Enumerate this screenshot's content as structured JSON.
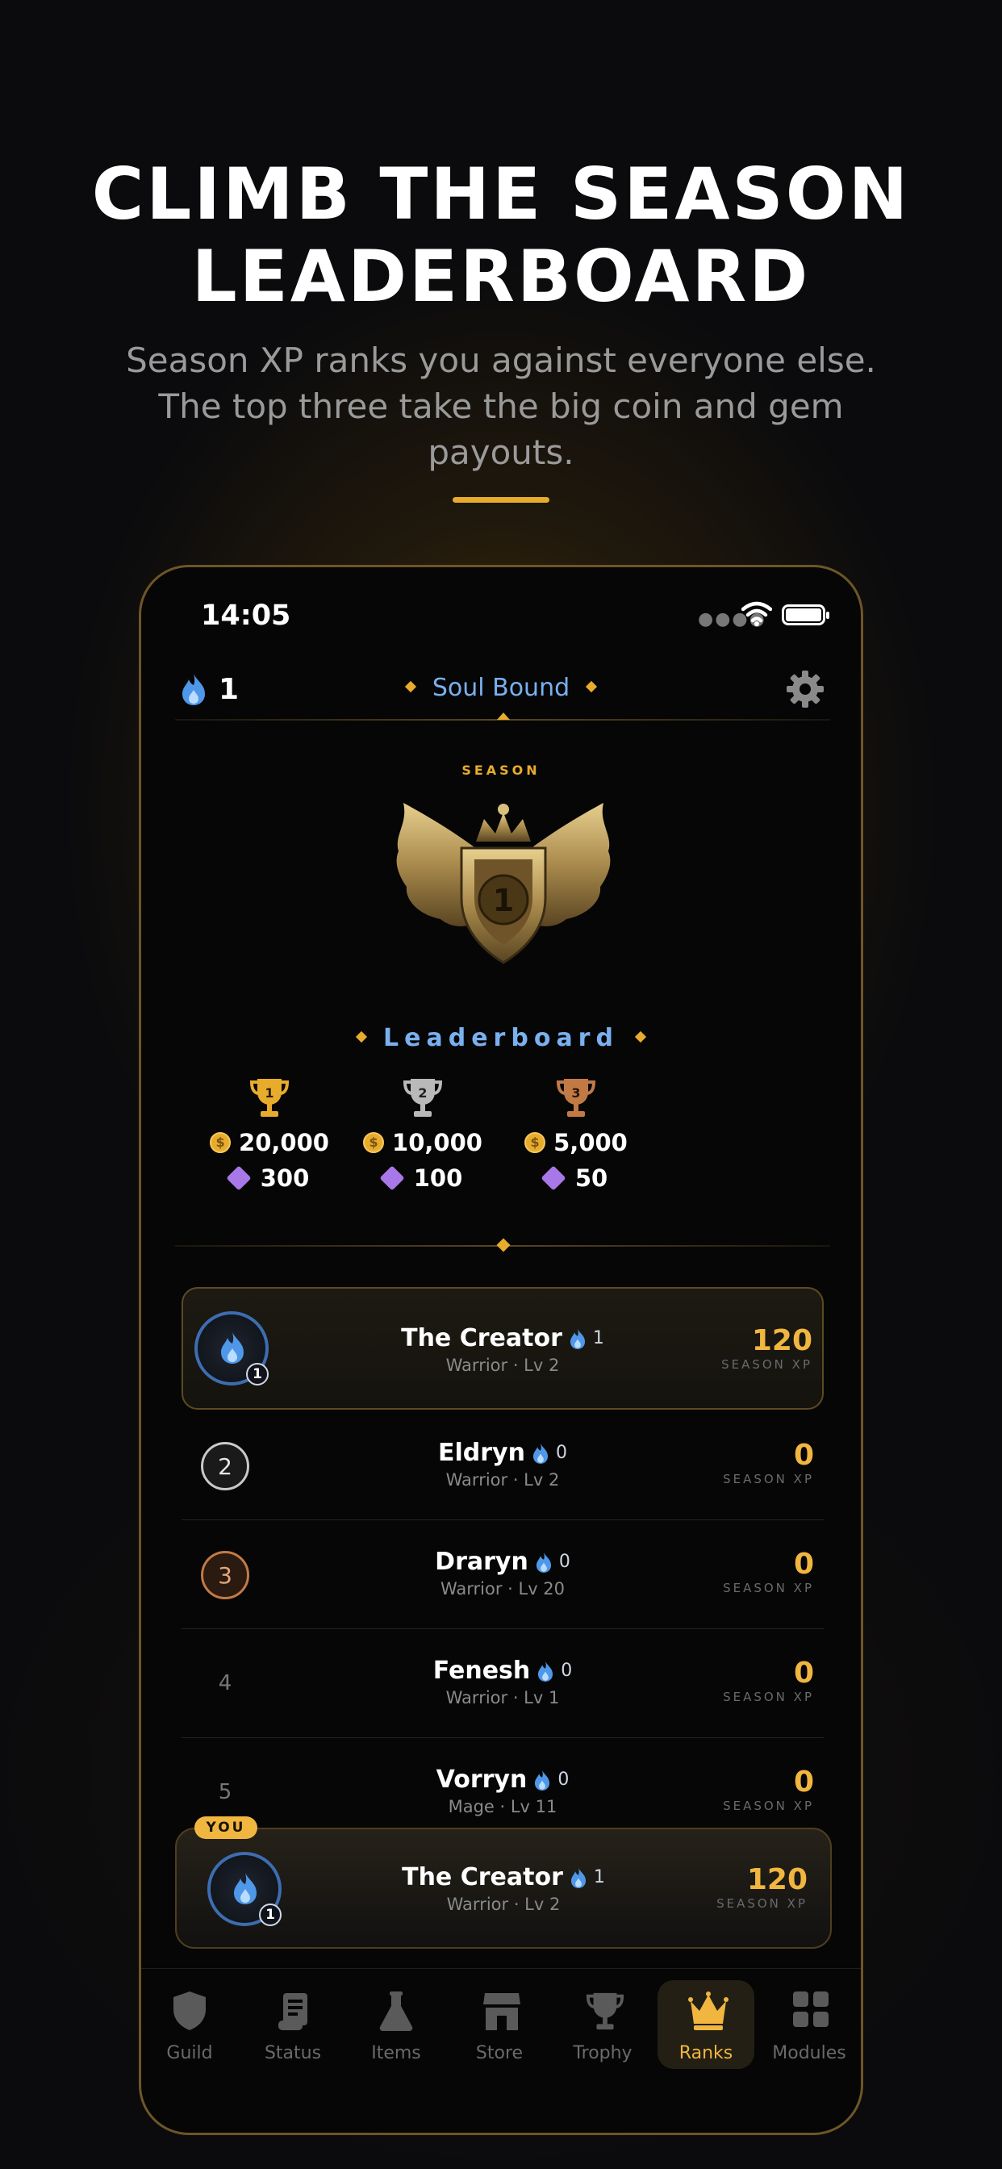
{
  "promo": {
    "headline_line1": "CLIMB THE SEASON",
    "headline_line2": "LEADERBOARD",
    "subtitle_line1": "Season XP ranks you against everyone else.",
    "subtitle_line2": "The top three take the big coin and gem",
    "subtitle_line3": "payouts."
  },
  "status_bar": {
    "time": "14:05"
  },
  "top_nav": {
    "streak_count": "1",
    "title": "Soul Bound"
  },
  "season": {
    "label": "SEASON",
    "emblem_number": "1"
  },
  "leaderboard": {
    "title": "Leaderboard",
    "prizes": [
      {
        "place": "1",
        "coins": "20,000",
        "gems": "300",
        "color": "#e8ac2d"
      },
      {
        "place": "2",
        "coins": "10,000",
        "gems": "100",
        "color": "#b9b9b9"
      },
      {
        "place": "3",
        "coins": "5,000",
        "gems": "50",
        "color": "#c27a45"
      }
    ],
    "rows": [
      {
        "rank": "1",
        "name": "The Creator",
        "streak": "1",
        "class_level": "Warrior · Lv 2",
        "xp": "120",
        "xp_label": "SEASON XP",
        "avatar_level": "1"
      },
      {
        "rank": "2",
        "name": "Eldryn",
        "streak": "0",
        "class_level": "Warrior · Lv 2",
        "xp": "0",
        "xp_label": "SEASON XP"
      },
      {
        "rank": "3",
        "name": "Draryn",
        "streak": "0",
        "class_level": "Warrior · Lv 20",
        "xp": "0",
        "xp_label": "SEASON XP"
      },
      {
        "rank": "4",
        "name": "Fenesh",
        "streak": "0",
        "class_level": "Warrior · Lv 1",
        "xp": "0",
        "xp_label": "SEASON XP"
      },
      {
        "rank": "5",
        "name": "Vorryn",
        "streak": "0",
        "class_level": "Mage · Lv 11",
        "xp": "0",
        "xp_label": "SEASON XP"
      }
    ]
  },
  "you_card": {
    "badge": "YOU",
    "name": "The Creator",
    "streak": "1",
    "class_level": "Warrior · Lv 2",
    "xp": "120",
    "xp_label": "SEASON XP",
    "avatar_level": "1"
  },
  "tabs": [
    {
      "label": "Guild",
      "icon": "shield-icon"
    },
    {
      "label": "Status",
      "icon": "scroll-icon"
    },
    {
      "label": "Items",
      "icon": "flask-icon"
    },
    {
      "label": "Store",
      "icon": "store-icon"
    },
    {
      "label": "Trophy",
      "icon": "trophy-icon"
    },
    {
      "label": "Ranks",
      "icon": "crown-icon",
      "active": true
    },
    {
      "label": "Modules",
      "icon": "grid-icon"
    }
  ],
  "colors": {
    "accent_gold": "#f0b640",
    "accent_blue": "#7ab0ee",
    "background": "#0b0b0d"
  }
}
